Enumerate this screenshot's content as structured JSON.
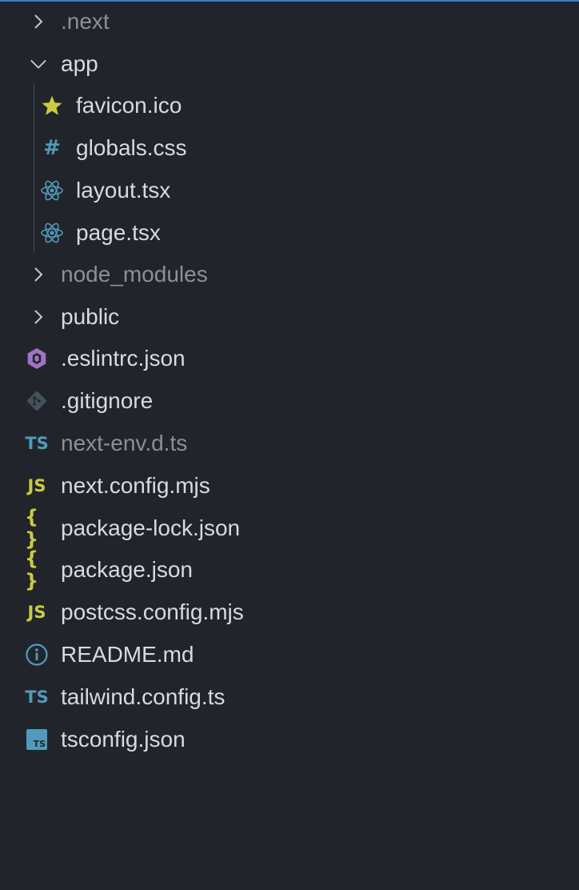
{
  "explorer": {
    "items": [
      {
        "label": ".next",
        "kind": "folder",
        "expanded": false,
        "depth": 0,
        "dim": true,
        "icon": "chevron-right-icon"
      },
      {
        "label": "app",
        "kind": "folder",
        "expanded": true,
        "depth": 0,
        "dim": false,
        "icon": "chevron-down-icon"
      },
      {
        "label": "favicon.ico",
        "kind": "file",
        "depth": 1,
        "icon": "star-icon",
        "icon_color": "#cbcb41"
      },
      {
        "label": "globals.css",
        "kind": "file",
        "depth": 1,
        "icon": "hash-icon",
        "icon_text": "#",
        "icon_color": "#519aba"
      },
      {
        "label": "layout.tsx",
        "kind": "file",
        "depth": 1,
        "icon": "react-icon",
        "icon_color": "#519aba"
      },
      {
        "label": "page.tsx",
        "kind": "file",
        "depth": 1,
        "icon": "react-icon",
        "icon_color": "#519aba"
      },
      {
        "label": "node_modules",
        "kind": "folder",
        "expanded": false,
        "depth": 0,
        "dim": true,
        "icon": "chevron-right-icon"
      },
      {
        "label": "public",
        "kind": "folder",
        "expanded": false,
        "depth": 0,
        "dim": false,
        "icon": "chevron-right-icon"
      },
      {
        "label": ".eslintrc.json",
        "kind": "file",
        "depth": 0,
        "icon": "eslint-icon",
        "icon_color": "#a074c4"
      },
      {
        "label": ".gitignore",
        "kind": "file",
        "depth": 0,
        "icon": "git-icon",
        "icon_color": "#41535b"
      },
      {
        "label": "next-env.d.ts",
        "kind": "file",
        "depth": 0,
        "dim": true,
        "icon": "typescript-icon",
        "icon_text": "TS",
        "icon_color": "#519aba"
      },
      {
        "label": "next.config.mjs",
        "kind": "file",
        "depth": 0,
        "icon": "javascript-icon",
        "icon_text": "JS",
        "icon_color": "#cbcb41"
      },
      {
        "label": "package-lock.json",
        "kind": "file",
        "depth": 0,
        "icon": "json-braces-icon",
        "icon_text": "{ }",
        "icon_color": "#cbcb41"
      },
      {
        "label": "package.json",
        "kind": "file",
        "depth": 0,
        "icon": "json-braces-icon",
        "icon_text": "{ }",
        "icon_color": "#cbcb41"
      },
      {
        "label": "postcss.config.mjs",
        "kind": "file",
        "depth": 0,
        "icon": "javascript-icon",
        "icon_text": "JS",
        "icon_color": "#cbcb41"
      },
      {
        "label": "README.md",
        "kind": "file",
        "depth": 0,
        "icon": "info-icon",
        "icon_color": "#519aba"
      },
      {
        "label": "tailwind.config.ts",
        "kind": "file",
        "depth": 0,
        "icon": "typescript-icon",
        "icon_text": "TS",
        "icon_color": "#519aba"
      },
      {
        "label": "tsconfig.json",
        "kind": "file",
        "depth": 0,
        "icon": "tsconfig-icon",
        "icon_text": "TS",
        "icon_color": "#519aba"
      }
    ]
  }
}
